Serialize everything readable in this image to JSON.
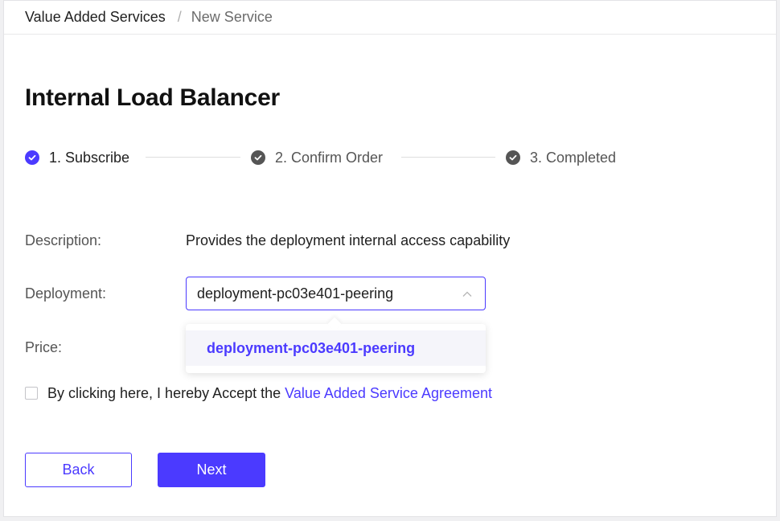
{
  "breadcrumb": {
    "items": [
      "Value Added Services",
      "New Service"
    ],
    "separator": "/"
  },
  "page": {
    "title": "Internal Load Balancer"
  },
  "steps": [
    {
      "label": "1. Subscribe",
      "state": "active"
    },
    {
      "label": "2. Confirm Order",
      "state": "done"
    },
    {
      "label": "3. Completed",
      "state": "done"
    }
  ],
  "form": {
    "description_label": "Description:",
    "description_value": "Provides the deployment internal access capability",
    "deployment_label": "Deployment:",
    "deployment_value": "deployment-pc03e401-peering",
    "deployment_options": [
      "deployment-pc03e401-peering"
    ],
    "price_label": "Price:",
    "agree_text": "By clicking here, I hereby Accept the",
    "agree_link": "Value Added Service Agreement",
    "agree_checked": false
  },
  "actions": {
    "back_label": "Back",
    "next_label": "Next"
  },
  "colors": {
    "accent": "#4b3aff",
    "step_done": "#555555"
  },
  "icons": {
    "step": "check-circle-icon",
    "select": "chevron-up-icon"
  }
}
